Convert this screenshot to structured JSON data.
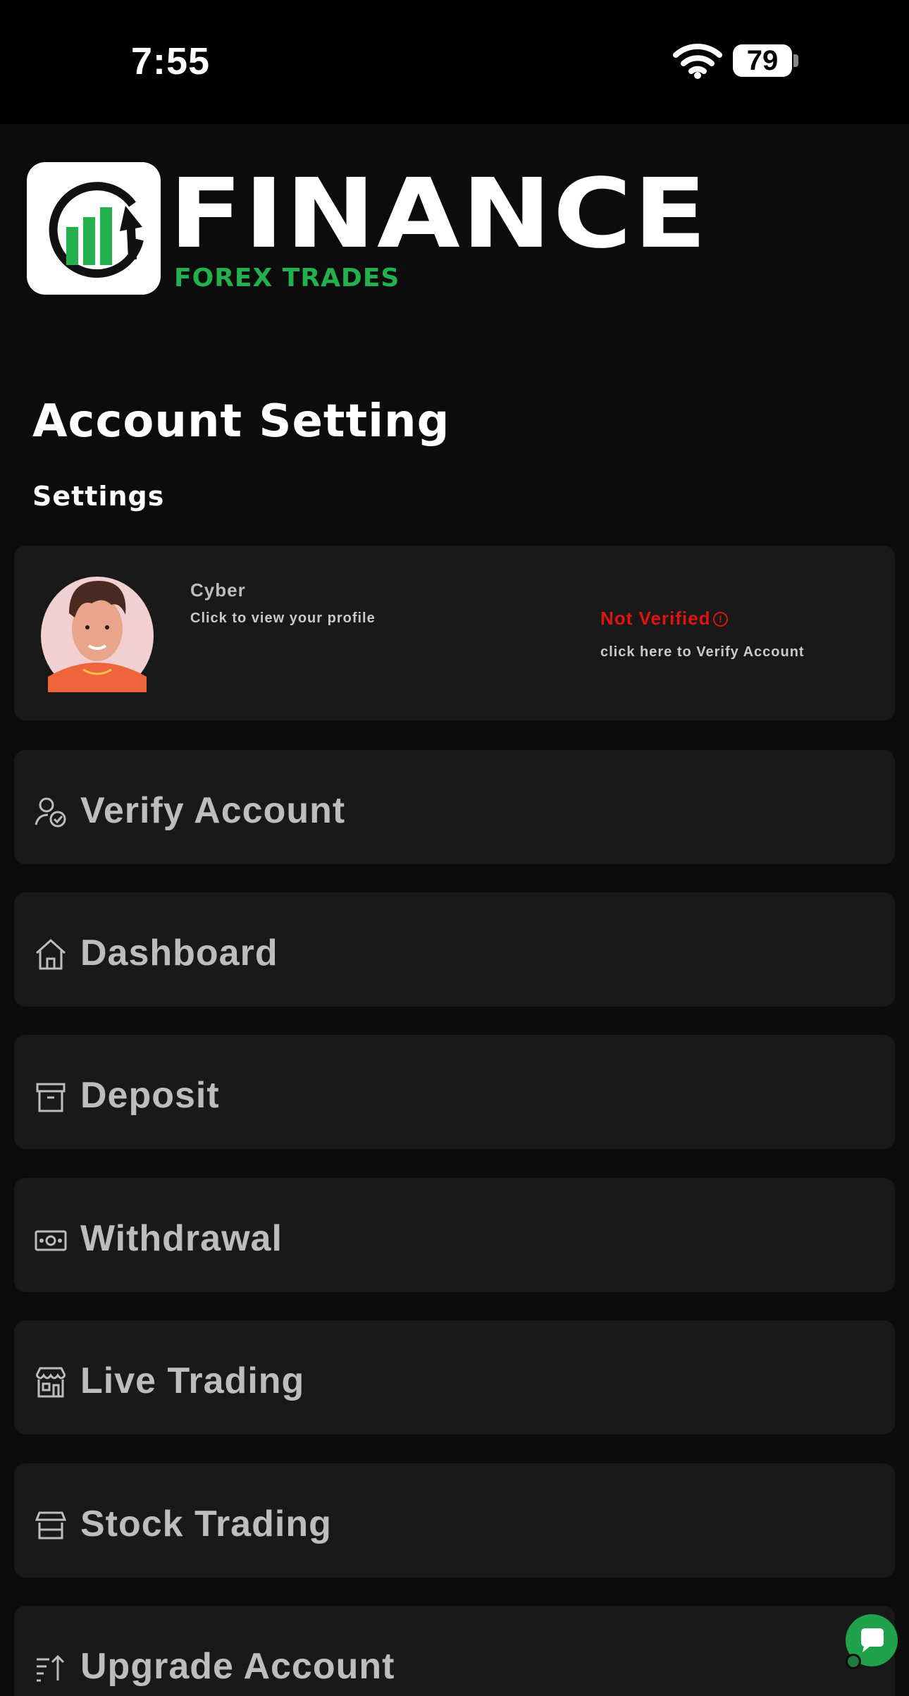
{
  "status_bar": {
    "time": "7:55",
    "battery": "79"
  },
  "brand": {
    "name": "FINANCE",
    "tagline": "FOREX TRADES"
  },
  "page": {
    "title": "Account Setting",
    "section": "Settings"
  },
  "profile": {
    "name": "Cyber",
    "subtitle": "Click to view your profile",
    "status": "Not Verified",
    "verify_link": "click here to Verify Account"
  },
  "menu": [
    {
      "label": "Verify Account",
      "icon": "user-check-icon"
    },
    {
      "label": "Dashboard",
      "icon": "home-icon"
    },
    {
      "label": "Deposit",
      "icon": "archive-icon"
    },
    {
      "label": "Withdrawal",
      "icon": "banknote-icon"
    },
    {
      "label": "Live Trading",
      "icon": "store-icon"
    },
    {
      "label": "Stock Trading",
      "icon": "shop-icon"
    },
    {
      "label": "Upgrade Account",
      "icon": "sort-up-icon"
    }
  ],
  "colors": {
    "accent": "#22b14c",
    "alert": "#e0140f",
    "card": "#191919",
    "background": "#0c0c0c"
  }
}
